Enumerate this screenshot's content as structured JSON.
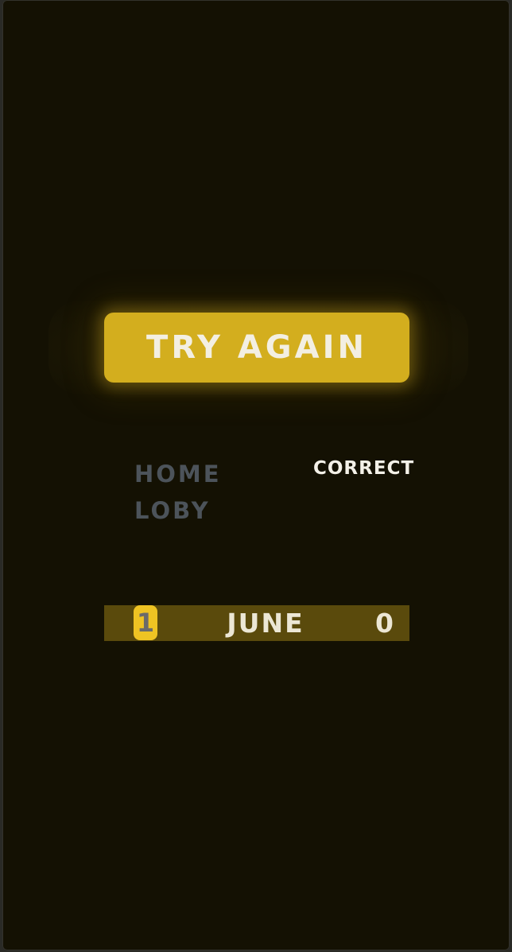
{
  "buttons": {
    "try_again": "TRY AGAIN"
  },
  "menu": {
    "home": "HOME",
    "lobby": "LOBY"
  },
  "result": {
    "status": "CORRECT"
  },
  "leaderboard": {
    "rows": [
      {
        "rank": "1",
        "name": "JUNE",
        "score": "0"
      }
    ]
  },
  "colors": {
    "background": "#141103",
    "accent": "#d3ae1e",
    "rank_badge": "#eec323",
    "row_bg": "#5a4a0c",
    "muted_link": "#4c535a"
  }
}
